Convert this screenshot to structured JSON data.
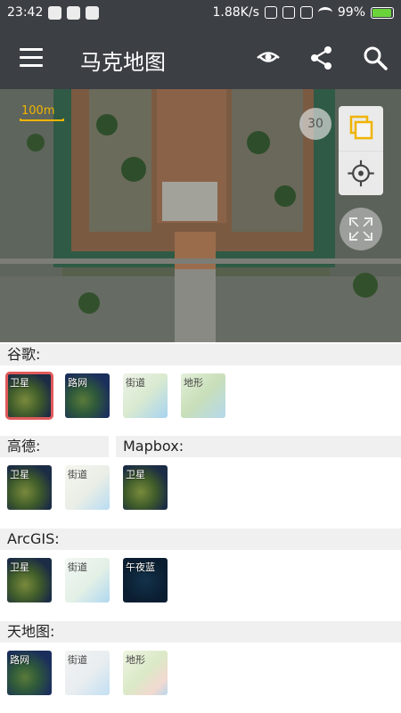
{
  "status": {
    "time": "23:42",
    "speed": "1.88K/s",
    "battery": "99%"
  },
  "appbar": {
    "title": "马克地图",
    "icons": [
      "menu-icon",
      "eye-icon",
      "share-icon",
      "search-icon"
    ]
  },
  "map": {
    "scale_label": "100m",
    "zoom_level": "30"
  },
  "sections": {
    "google": {
      "title": "谷歌:",
      "tiles": [
        {
          "label": "卫星",
          "selected": true
        },
        {
          "label": "路网"
        },
        {
          "label": "街道"
        },
        {
          "label": "地形"
        }
      ]
    },
    "gaode": {
      "title": "高德:",
      "tiles": [
        {
          "label": "卫星"
        },
        {
          "label": "街道"
        }
      ]
    },
    "mapbox": {
      "title": "Mapbox:",
      "tiles": [
        {
          "label": "卫星"
        }
      ]
    },
    "arcgis": {
      "title": "ArcGIS:",
      "tiles": [
        {
          "label": "卫星"
        },
        {
          "label": "街道"
        },
        {
          "label": "午夜蓝"
        }
      ]
    },
    "tianditu": {
      "title": "天地图:",
      "tiles": [
        {
          "label": "路网"
        },
        {
          "label": "街道"
        },
        {
          "label": "地形"
        }
      ]
    }
  },
  "colors": {
    "appbar": "#3c3f44",
    "accent": "#f0b400",
    "selected_border": "#e05a5a",
    "section_bg": "#f0f0f0"
  }
}
